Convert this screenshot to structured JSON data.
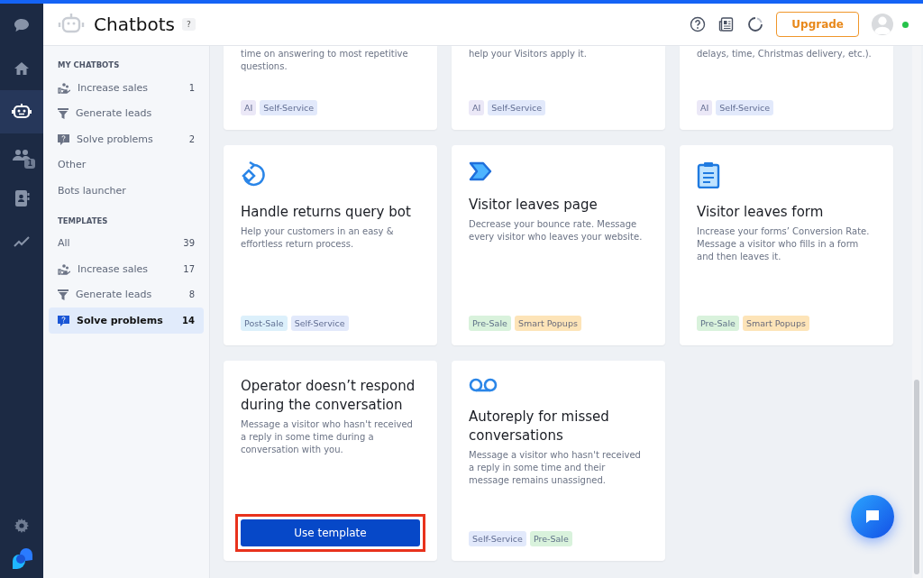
{
  "rail": {
    "items": [
      {
        "kind": "chat",
        "selected": false
      },
      {
        "kind": "home",
        "selected": false
      },
      {
        "kind": "bot",
        "selected": true
      },
      {
        "kind": "team",
        "selected": false,
        "badge": "1"
      },
      {
        "kind": "contacts",
        "selected": false
      },
      {
        "kind": "reports",
        "selected": false
      }
    ]
  },
  "header": {
    "title": "Chatbots",
    "help": "?",
    "upgrade": "Upgrade",
    "online": true
  },
  "sidebar": {
    "sections": [
      {
        "heading": "MY CHATBOTS",
        "items": [
          {
            "label": "Increase sales",
            "kind": "sales",
            "count": "1",
            "selected": false
          },
          {
            "label": "Generate leads",
            "kind": "leads",
            "selected": false
          },
          {
            "label": "Solve problems",
            "kind": "problems",
            "count": "2",
            "selected": false
          },
          {
            "label": "Other",
            "kind": "plain",
            "selected": false
          },
          {
            "label": "Bots launcher",
            "kind": "plain",
            "selected": false
          }
        ]
      },
      {
        "heading": "TEMPLATES",
        "items": [
          {
            "label": "All",
            "kind": "plain",
            "count": "39",
            "selected": false
          },
          {
            "label": "Increase sales",
            "kind": "sales",
            "count": "17",
            "selected": false
          },
          {
            "label": "Generate leads",
            "kind": "leads",
            "count": "8",
            "selected": false
          },
          {
            "label": "Solve problems",
            "kind": "problems",
            "count": "14",
            "selected": true
          }
        ]
      }
    ]
  },
  "cards": [
    {
      "kind": "plain",
      "description": "time on answering to most repetitive questions.",
      "tags": [
        {
          "label": "AI",
          "color": "#ebe8f7"
        },
        {
          "label": "Self-Service",
          "color": "#e2e9fb"
        }
      ]
    },
    {
      "kind": "plain",
      "description": "help your Visitors apply it.",
      "tags": [
        {
          "label": "AI",
          "color": "#ebe8f7"
        },
        {
          "label": "Self-Service",
          "color": "#e2e9fb"
        }
      ]
    },
    {
      "kind": "plain",
      "description": "delays, time, Christmas delivery, etc.).",
      "tags": [
        {
          "label": "AI",
          "color": "#ebe8f7"
        },
        {
          "label": "Self-Service",
          "color": "#e2e9fb"
        }
      ]
    },
    {
      "kind": "returns",
      "title": "Handle returns query bot",
      "description": "Help your customers in an easy & effortless return process.",
      "tags": [
        {
          "label": "Post-Sale",
          "color": "#dcf0fb"
        },
        {
          "label": "Self-Service",
          "color": "#e2e9fb"
        }
      ]
    },
    {
      "kind": "chevron",
      "title": "Visitor leaves page",
      "description": "Decrease your bounce rate. Message every visitor who leaves your website.",
      "tags": [
        {
          "label": "Pre-Sale",
          "color": "#d9f2dc"
        },
        {
          "label": "Smart Popups",
          "color": "#fde4b8"
        }
      ]
    },
    {
      "kind": "clipboard",
      "title": "Visitor leaves form",
      "description": "Increase your forms’ Conversion Rate. Message a visitor who fills in a form and then leaves it.",
      "tags": [
        {
          "label": "Pre-Sale",
          "color": "#d9f2dc"
        },
        {
          "label": "Smart Popups",
          "color": "#fde4b8"
        }
      ]
    },
    {
      "kind": "plain",
      "title": "Operator doesn’t respond during the conversation",
      "description": "Message a visitor who hasn't received a reply in some time during a conversation with you.",
      "button": "Use template",
      "highlighted": true
    },
    {
      "kind": "voicemail",
      "title": "Autoreply for missed conversations",
      "description": "Message a visitor who hasn't received a reply in some time and their message remains unassigned.",
      "tags": [
        {
          "label": "Self-Service",
          "color": "#e2e9fb"
        },
        {
          "label": "Pre-Sale",
          "color": "#d9f2dc"
        }
      ]
    }
  ]
}
